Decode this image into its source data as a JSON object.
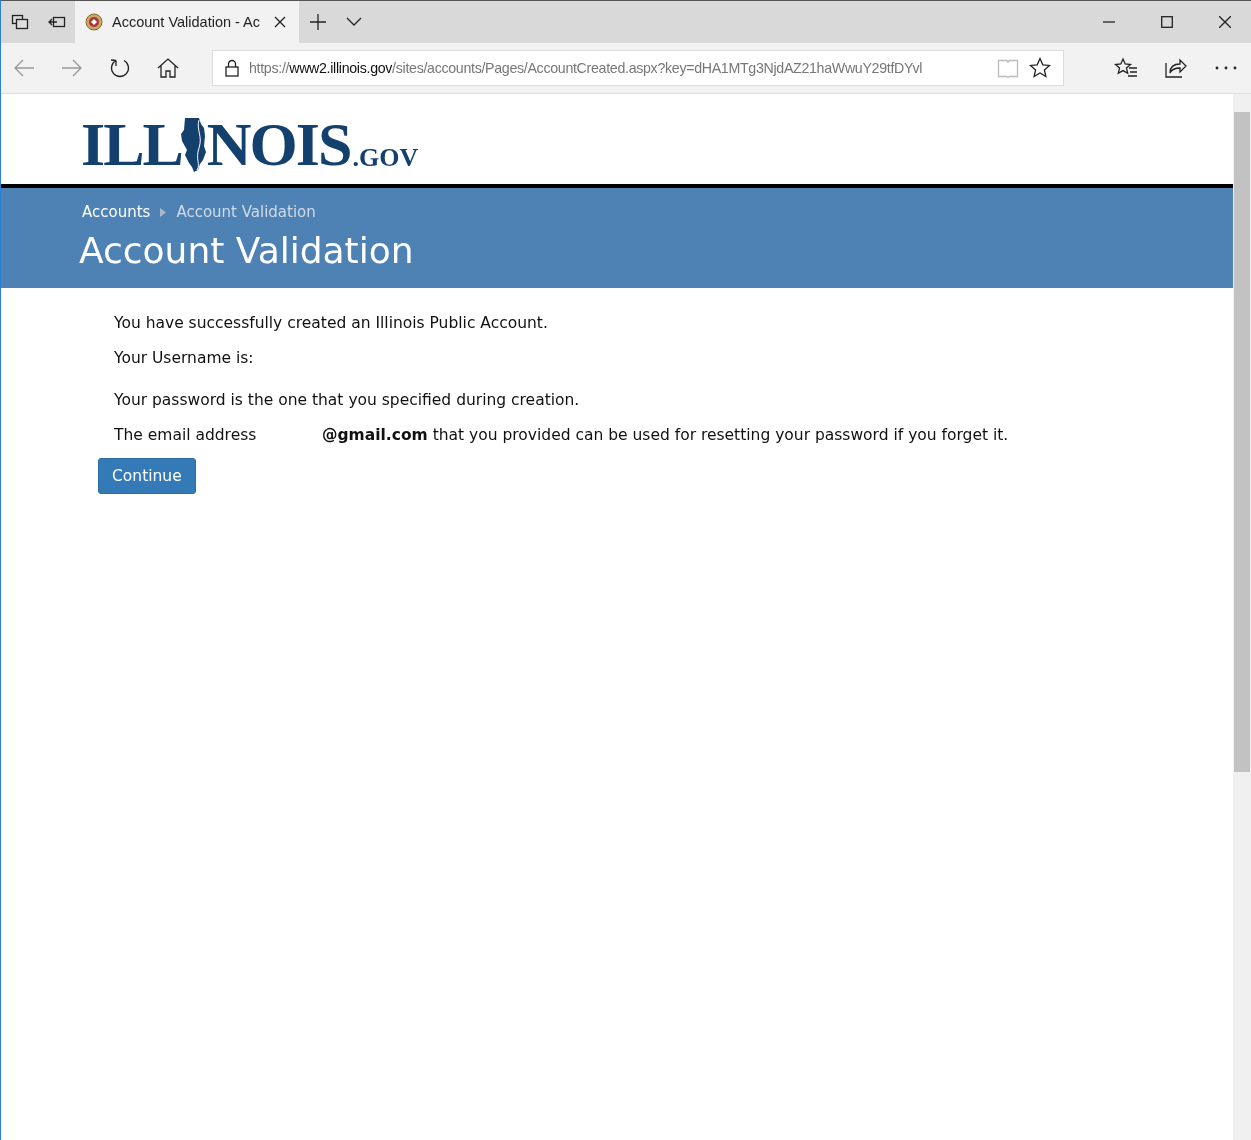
{
  "browser": {
    "tabs": [
      {
        "title": "Account Validation - Ac",
        "selected": true
      }
    ],
    "address": {
      "scheme": "https://",
      "host": "www2.illinois.gov",
      "path": "/sites/accounts/Pages/AccountCreated.aspx?key=dHA1MTg3NjdAZ21haWwuY29tfDYvl"
    }
  },
  "header": {
    "logo": {
      "before": "ILL",
      "after": "NOIS",
      "suffix": ".GOV"
    }
  },
  "breadcrumb": [
    {
      "label": "Accounts",
      "current": false
    },
    {
      "label": "Account Validation",
      "current": true
    }
  ],
  "page_title": "Account Validation",
  "messages": [
    {
      "text": "You have successfully created an Illinois Public Account."
    },
    {
      "text": "Your Username is:"
    },
    {
      "text": "Your password is the one that you specified during creation."
    },
    {
      "label": "The email address",
      "text": "**@gmail.com** that you provided can be used for resetting your password if you forget it."
    }
  ],
  "buttons": [
    "Continue"
  ]
}
